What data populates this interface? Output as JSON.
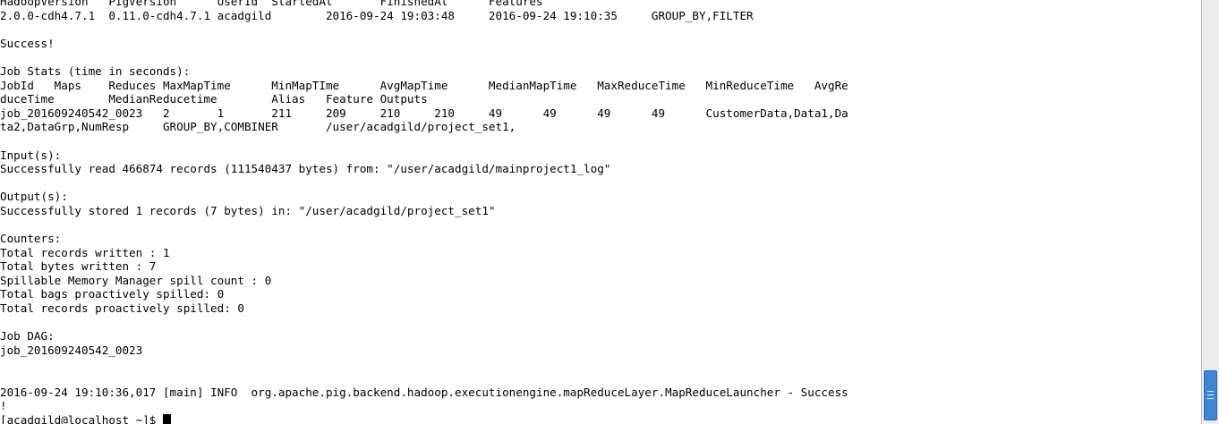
{
  "terminal": {
    "lines": [
      "HadoopVersion   PigVersion      UserId  StartedAt       FinishedAt      Features",
      "2.0.0-cdh4.7.1  0.11.0-cdh4.7.1 acadgild        2016-09-24 19:03:48     2016-09-24 19:10:35     GROUP_BY,FILTER",
      "",
      "Success!",
      "",
      "Job Stats (time in seconds):",
      "JobId   Maps    Reduces MaxMapTime      MinMapTIme      AvgMapTime      MedianMapTime   MaxReduceTime   MinReduceTime   AvgRe",
      "duceTime        MedianReducetime        Alias   Feature Outputs",
      "job_201609240542_0023   2       1       211     209     210     210     49      49      49      49      CustomerData,Data1,Da",
      "ta2,DataGrp,NumResp     GROUP_BY,COMBINER       /user/acadgild/project_set1,",
      "",
      "Input(s):",
      "Successfully read 466874 records (111540437 bytes) from: \"/user/acadgild/mainproject1_log\"",
      "",
      "Output(s):",
      "Successfully stored 1 records (7 bytes) in: \"/user/acadgild/project_set1\"",
      "",
      "Counters:",
      "Total records written : 1",
      "Total bytes written : 7",
      "Spillable Memory Manager spill count : 0",
      "Total bags proactively spilled: 0",
      "Total records proactively spilled: 0",
      "",
      "Job DAG:",
      "job_201609240542_0023",
      "",
      "",
      "2016-09-24 19:10:36,017 [main] INFO  org.apache.pig.backend.hadoop.executionengine.mapReduceLayer.MapReduceLauncher - Success",
      "!"
    ],
    "prompt": "[acadgild@localhost ~]$ "
  }
}
